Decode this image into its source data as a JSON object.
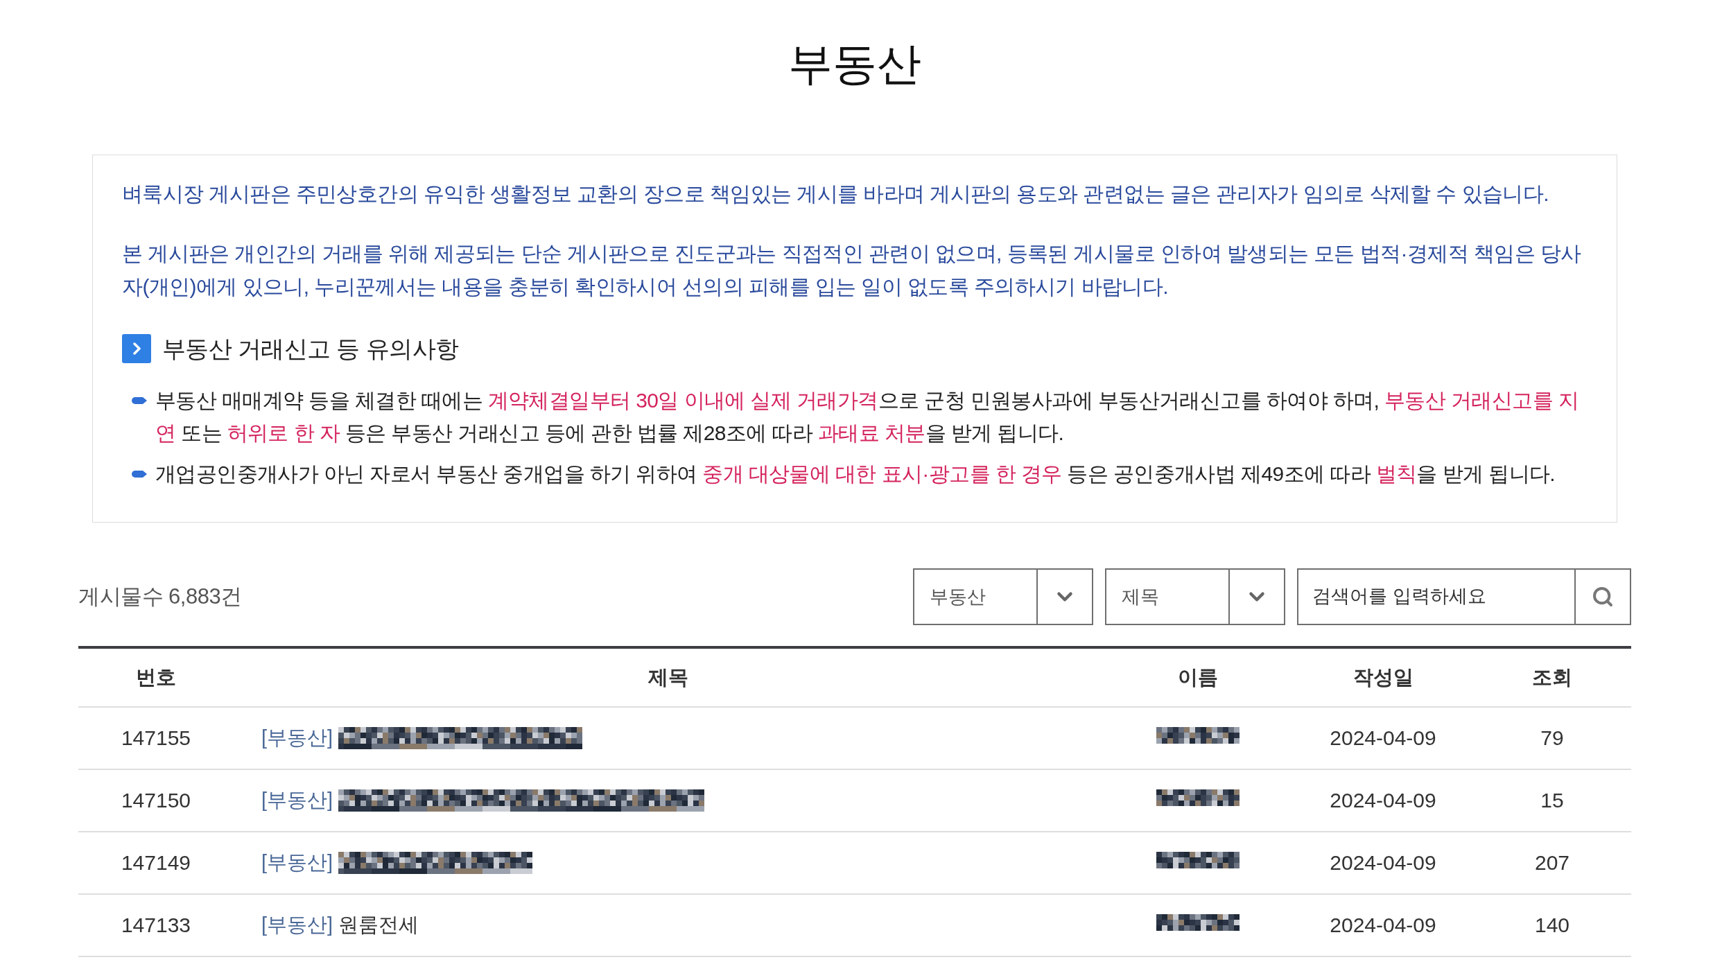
{
  "page": {
    "title": "부동산"
  },
  "notice": {
    "paragraphs": [
      "벼룩시장 게시판은 주민상호간의 유익한 생활정보 교환의 장으로 책임있는 게시를 바라며 게시판의 용도와 관련없는 글은 관리자가 임의로 삭제할 수 있습니다.",
      "본 게시판은 개인간의 거래를 위해 제공되는 단순 게시판으로 진도군과는 직접적인 관련이 없으며, 등록된 게시물로 인하여 발생되는 모든 법적·경제적 책임은 당사자(개인)에게 있으니, 누리꾼께서는 내용을 충분히 확인하시어 선의의 피해를 입는 일이 없도록 주의하시기 바랍니다."
    ],
    "caution": {
      "heading": "부동산 거래신고 등 유의사항",
      "items": [
        {
          "segments": [
            {
              "text": "부동산 매매계약 등을 체결한 때에는 ",
              "highlight": false
            },
            {
              "text": "계약체결일부터 30일 이내에 실제 거래가격",
              "highlight": true
            },
            {
              "text": "으로 군청 민원봉사과에 부동산거래신고를 하여야 하며, ",
              "highlight": false
            },
            {
              "text": "부동산 거래신고를 지연",
              "highlight": true
            },
            {
              "text": " 또는 ",
              "highlight": false
            },
            {
              "text": "허위로 한 자",
              "highlight": true
            },
            {
              "text": " 등은 부동산 거래신고 등에 관한 법률 제28조에 따라 ",
              "highlight": false
            },
            {
              "text": "과태료 처분",
              "highlight": true
            },
            {
              "text": "을 받게 됩니다.",
              "highlight": false
            }
          ]
        },
        {
          "segments": [
            {
              "text": "개업공인중개사가 아닌 자로서 부동산 중개업을 하기 위하여 ",
              "highlight": false
            },
            {
              "text": "중개 대상물에 대한 표시·광고를 한 경우",
              "highlight": true
            },
            {
              "text": " 등은 공인중개사법 제49조에 따라 ",
              "highlight": false
            },
            {
              "text": "벌칙",
              "highlight": true
            },
            {
              "text": "을 받게 됩니다.",
              "highlight": false
            }
          ]
        }
      ]
    }
  },
  "board": {
    "count": "게시물수 6,883건",
    "filters": [
      {
        "value": "부동산"
      },
      {
        "value": "제목"
      }
    ],
    "search": {
      "placeholder": "검색어를 입력하세요"
    },
    "table": {
      "columns": [
        "번호",
        "제목",
        "이름",
        "작성일",
        "조회"
      ],
      "rows": [
        {
          "number": "147155",
          "category": "[부동산]",
          "title_redacted": true,
          "name_redacted": true,
          "date": "2024-04-09",
          "views": "79"
        },
        {
          "number": "147150",
          "category": "[부동산]",
          "title_redacted": true,
          "name_redacted": true,
          "date": "2024-04-09",
          "views": "15"
        },
        {
          "number": "147149",
          "category": "[부동산]",
          "title_redacted": true,
          "name_redacted": true,
          "date": "2024-04-09",
          "views": "207"
        },
        {
          "number": "147133",
          "category": "[부동산]",
          "title": "원룸전세",
          "title_redacted": false,
          "name_redacted": true,
          "date": "2024-04-09",
          "views": "140"
        }
      ]
    }
  }
}
